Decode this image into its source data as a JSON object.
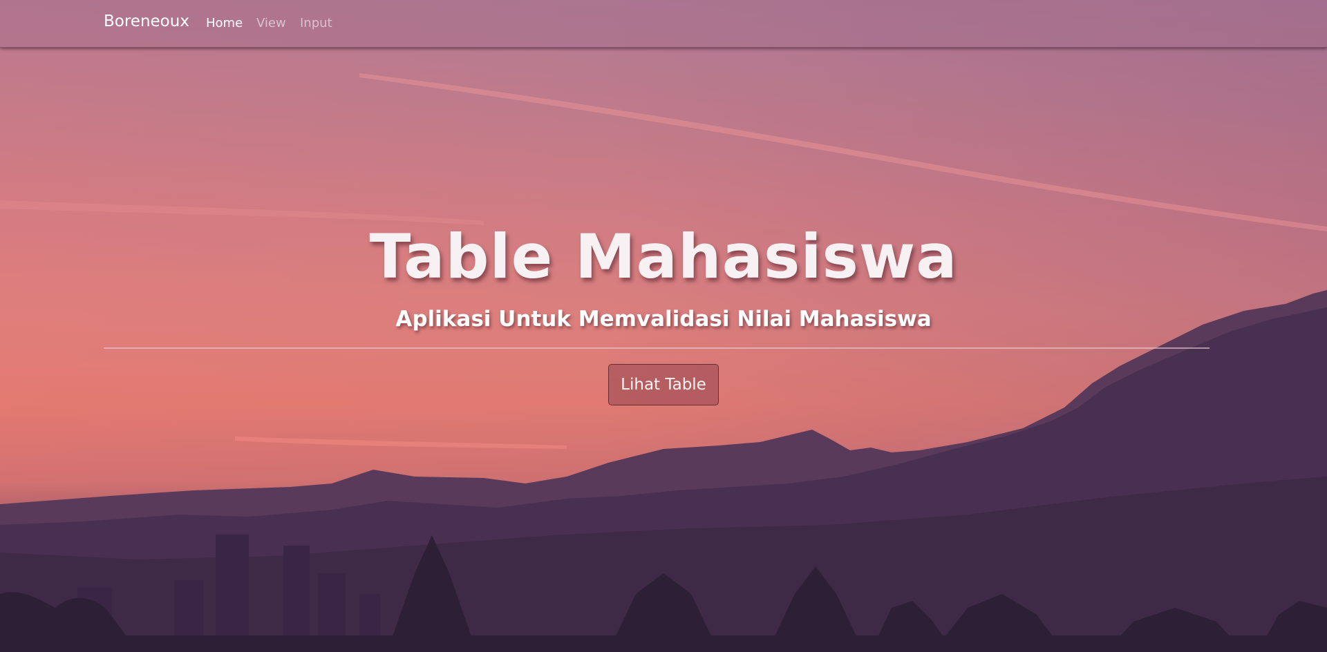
{
  "navbar": {
    "brand": "Boreneoux",
    "links": [
      {
        "label": "Home",
        "active": true
      },
      {
        "label": "View",
        "active": false
      },
      {
        "label": "Input",
        "active": false
      }
    ]
  },
  "hero": {
    "title": "Table Mahasiswa",
    "subtitle": "Aplikasi Untuk Memvalidasi Nilai Mahasiswa",
    "button_label": "Lihat Table"
  },
  "colors": {
    "sky_top": "#b27a94",
    "sky_bottom": "#e07a72",
    "mountain": "#4a3050",
    "navbar_bg": "#a56e8c"
  }
}
